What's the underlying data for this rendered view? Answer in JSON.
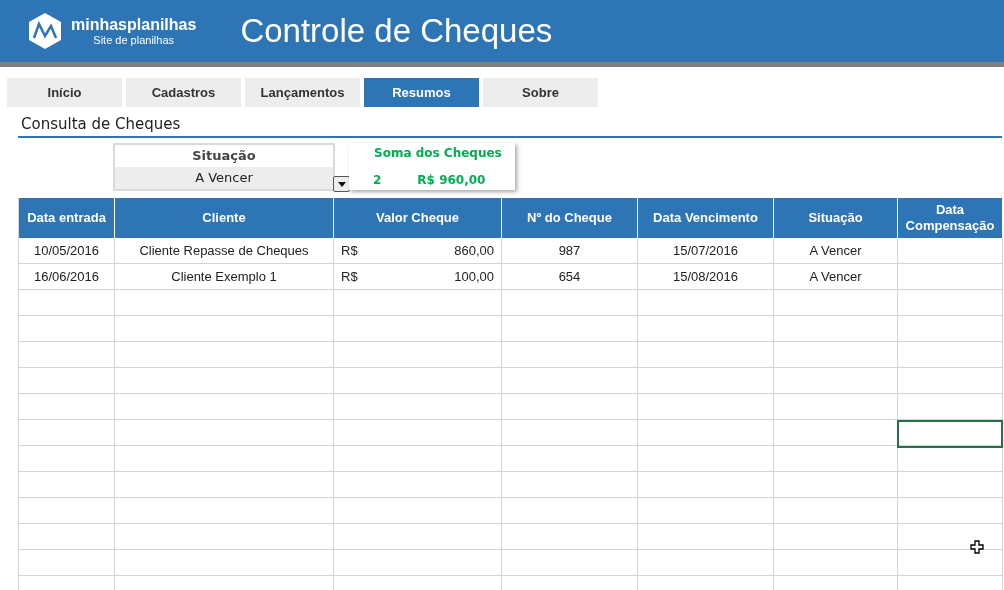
{
  "header": {
    "logo_name": "minhasplanilhas",
    "logo_tagline": "Site de planilhas",
    "title": "Controle de Cheques"
  },
  "tabs": [
    {
      "label": "Início",
      "selected": false
    },
    {
      "label": "Cadastros",
      "selected": false
    },
    {
      "label": "Lançamentos",
      "selected": false
    },
    {
      "label": "Resumos",
      "selected": true
    },
    {
      "label": "Sobre",
      "selected": false
    }
  ],
  "section_title": "Consulta de Cheques",
  "filter": {
    "label": "Situação",
    "value": "A Vencer"
  },
  "summary": {
    "title": "Soma dos Cheques",
    "count": "2",
    "total": "R$ 960,00"
  },
  "table": {
    "columns": [
      "Data entrada",
      "Cliente",
      "Valor Cheque",
      "Nº do Cheque",
      "Data Vencimento",
      "Situação",
      "Data Compensação"
    ],
    "rows": [
      {
        "data_entrada": "10/05/2016",
        "cliente": "Cliente Repasse de Cheques",
        "currency": "R$",
        "valor": "860,00",
        "numero": "987",
        "vencimento": "15/07/2016",
        "situacao": "A Vencer"
      },
      {
        "data_entrada": "16/06/2016",
        "cliente": "Cliente Exemplo 1",
        "currency": "R$",
        "valor": "100,00",
        "numero": "654",
        "vencimento": "15/08/2016",
        "situacao": "A Vencer"
      }
    ]
  }
}
